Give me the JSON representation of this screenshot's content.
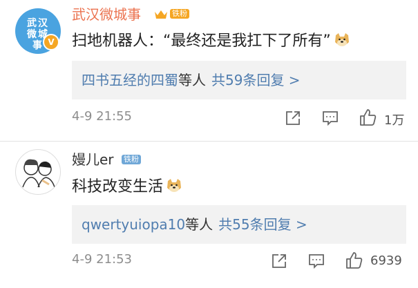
{
  "comments": [
    {
      "avatar_text": "武汉微城事",
      "verified_badge": "V",
      "username": "武汉微城事",
      "fan_badge": "铁粉",
      "text": "扫地机器人：“最终还是我扛下了所有”",
      "reply_users": "四书五经的四蜀",
      "reply_mid": "等人",
      "reply_tail": "共59条回复 >",
      "time": "4-9 21:55",
      "likes": "1万",
      "icons": [
        "crown-icon",
        "doge-emoji",
        "share-icon",
        "comment-icon",
        "like-icon"
      ],
      "colors": {
        "username": "#eb7350",
        "link": "#507daf",
        "avatar_bg": "#4aa3e0"
      }
    },
    {
      "username": "嫚儿er",
      "fan_badge": "铁粉",
      "text": "科技改变生活",
      "reply_users": "qwertyuiopa10",
      "reply_mid": "等人",
      "reply_tail": "共55条回复 >",
      "time": "4-9 21:53",
      "likes": "6939",
      "icons": [
        "doge-emoji",
        "share-icon",
        "comment-icon",
        "like-icon"
      ],
      "colors": {
        "username": "#333333",
        "link": "#507daf"
      }
    }
  ]
}
